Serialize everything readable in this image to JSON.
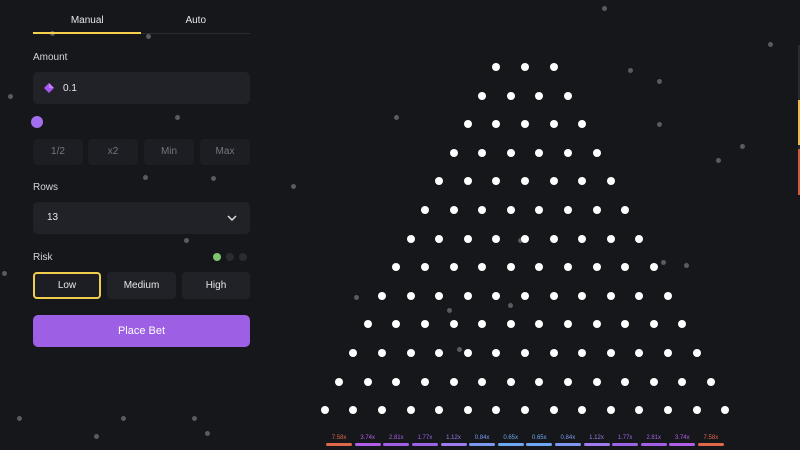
{
  "tabs": [
    {
      "label": "Manual",
      "active": true
    },
    {
      "label": "Auto",
      "active": false
    }
  ],
  "amount": {
    "label": "Amount",
    "value": "0.1",
    "currency_icon": "diamond-gem-icon",
    "currency_color": "#a855f7"
  },
  "quick_buttons": [
    "1/2",
    "x2",
    "Min",
    "Max"
  ],
  "rows": {
    "label": "Rows",
    "value": "13"
  },
  "risk": {
    "label": "Risk",
    "options": [
      "Low",
      "Medium",
      "High"
    ],
    "selected": "Low"
  },
  "place_bet_label": "Place Bet",
  "board": {
    "rows": 13,
    "first_row_pegs": 3
  },
  "multipliers": [
    {
      "label": "7.58x",
      "color": "#e0684a"
    },
    {
      "label": "3.74x",
      "color": "#b25fe8"
    },
    {
      "label": "2.81x",
      "color": "#a35ee6"
    },
    {
      "label": "1.77x",
      "color": "#9a63e8"
    },
    {
      "label": "1.12x",
      "color": "#9e7bf0"
    },
    {
      "label": "0.84x",
      "color": "#7f98f2"
    },
    {
      "label": "0.65x",
      "color": "#6ea8f4"
    },
    {
      "label": "0.65x",
      "color": "#6ea8f4"
    },
    {
      "label": "0.84x",
      "color": "#7f98f2"
    },
    {
      "label": "1.12x",
      "color": "#9e7bf0"
    },
    {
      "label": "1.77x",
      "color": "#9a63e8"
    },
    {
      "label": "2.81x",
      "color": "#a35ee6"
    },
    {
      "label": "3.74x",
      "color": "#b25fe8"
    },
    {
      "label": "7.58x",
      "color": "#e0684a"
    }
  ]
}
